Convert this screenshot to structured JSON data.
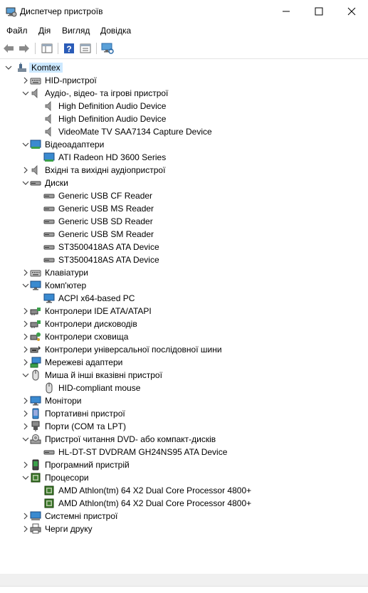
{
  "window": {
    "title": "Диспетчер пристроїв"
  },
  "menu": [
    "Файл",
    "Дія",
    "Вигляд",
    "Довідка"
  ],
  "tree": [
    {
      "label": "Komtex",
      "level": 0,
      "exp": "down",
      "icon": "computer-icon",
      "sel": true
    },
    {
      "label": "HID-пристрої",
      "level": 1,
      "exp": "right",
      "icon": "keyboard-icon"
    },
    {
      "label": "Аудіо-, відео- та ігрові пристрої",
      "level": 1,
      "exp": "down",
      "icon": "speaker-icon"
    },
    {
      "label": "High Definition Audio Device",
      "level": 2,
      "exp": "none",
      "icon": "speaker-icon"
    },
    {
      "label": "High Definition Audio Device",
      "level": 2,
      "exp": "none",
      "icon": "speaker-icon"
    },
    {
      "label": "VideoMate TV SAA7134 Capture Device",
      "level": 2,
      "exp": "none",
      "icon": "speaker-icon"
    },
    {
      "label": "Відеоадаптери",
      "level": 1,
      "exp": "down",
      "icon": "display-adapter-icon"
    },
    {
      "label": "ATI Radeon HD 3600 Series",
      "level": 2,
      "exp": "none",
      "icon": "display-adapter-icon"
    },
    {
      "label": "Вхідні та вихідні аудіопристрої",
      "level": 1,
      "exp": "right",
      "icon": "speaker-icon"
    },
    {
      "label": "Диски",
      "level": 1,
      "exp": "down",
      "icon": "disk-drive-icon"
    },
    {
      "label": "Generic USB CF Reader",
      "level": 2,
      "exp": "none",
      "icon": "disk-drive-icon"
    },
    {
      "label": "Generic USB MS Reader",
      "level": 2,
      "exp": "none",
      "icon": "disk-drive-icon"
    },
    {
      "label": "Generic USB SD Reader",
      "level": 2,
      "exp": "none",
      "icon": "disk-drive-icon"
    },
    {
      "label": "Generic USB SM Reader",
      "level": 2,
      "exp": "none",
      "icon": "disk-drive-icon"
    },
    {
      "label": "ST3500418AS ATA Device",
      "level": 2,
      "exp": "none",
      "icon": "disk-drive-icon"
    },
    {
      "label": "ST3500418AS ATA Device",
      "level": 2,
      "exp": "none",
      "icon": "disk-drive-icon"
    },
    {
      "label": "Клавіатури",
      "level": 1,
      "exp": "right",
      "icon": "keyboard-icon"
    },
    {
      "label": "Комп'ютер",
      "level": 1,
      "exp": "down",
      "icon": "monitor-icon"
    },
    {
      "label": "ACPI x64-based PC",
      "level": 2,
      "exp": "none",
      "icon": "monitor-icon"
    },
    {
      "label": "Контролери IDE ATA/ATAPI",
      "level": 1,
      "exp": "right",
      "icon": "controller-icon"
    },
    {
      "label": "Контролери дисководів",
      "level": 1,
      "exp": "right",
      "icon": "controller-icon"
    },
    {
      "label": "Контролери сховища",
      "level": 1,
      "exp": "right",
      "icon": "storage-controller-icon"
    },
    {
      "label": "Контролери універсальної послідовної шини",
      "level": 1,
      "exp": "right",
      "icon": "usb-icon"
    },
    {
      "label": "Мережеві адаптери",
      "level": 1,
      "exp": "right",
      "icon": "network-icon"
    },
    {
      "label": "Миша й інші вказівні пристрої",
      "level": 1,
      "exp": "down",
      "icon": "mouse-icon"
    },
    {
      "label": "HID-compliant mouse",
      "level": 2,
      "exp": "none",
      "icon": "mouse-icon"
    },
    {
      "label": "Монітори",
      "level": 1,
      "exp": "right",
      "icon": "monitor-icon"
    },
    {
      "label": "Портативні пристрої",
      "level": 1,
      "exp": "right",
      "icon": "portable-device-icon"
    },
    {
      "label": "Порти (COM та LPT)",
      "level": 1,
      "exp": "right",
      "icon": "port-icon"
    },
    {
      "label": "Пристрої читання DVD- або компакт-дисків",
      "level": 1,
      "exp": "down",
      "icon": "dvd-icon"
    },
    {
      "label": "HL-DT-ST DVDRAM GH24NS95 ATA Device",
      "level": 2,
      "exp": "none",
      "icon": "disk-drive-icon"
    },
    {
      "label": "Програмний пристрій",
      "level": 1,
      "exp": "right",
      "icon": "software-device-icon"
    },
    {
      "label": "Процесори",
      "level": 1,
      "exp": "down",
      "icon": "processor-icon"
    },
    {
      "label": "AMD Athlon(tm) 64 X2 Dual Core Processor 4800+",
      "level": 2,
      "exp": "none",
      "icon": "processor-icon"
    },
    {
      "label": "AMD Athlon(tm) 64 X2 Dual Core Processor 4800+",
      "level": 2,
      "exp": "none",
      "icon": "processor-icon"
    },
    {
      "label": "Системні пристрої",
      "level": 1,
      "exp": "right",
      "icon": "system-device-icon"
    },
    {
      "label": "Черги друку",
      "level": 1,
      "exp": "right",
      "icon": "printer-icon"
    }
  ]
}
